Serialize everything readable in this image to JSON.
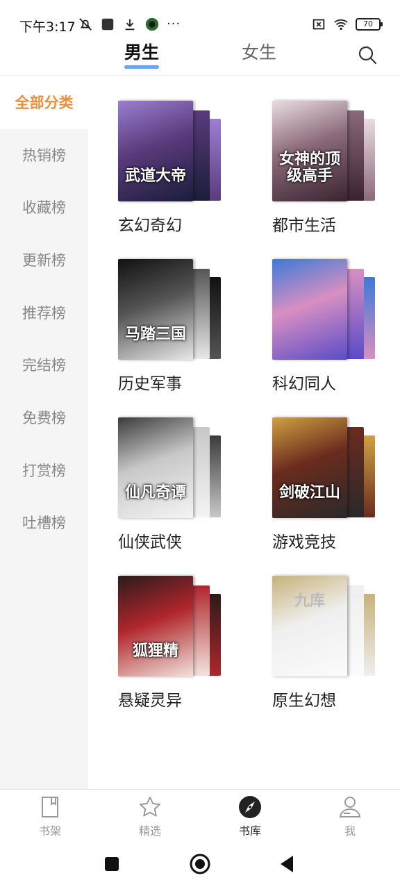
{
  "status_bar": {
    "time": "下午3:17",
    "battery": "70",
    "icons_left": [
      "mute-icon",
      "app-square-icon",
      "download-icon",
      "app-badge-icon",
      "more-dots-icon"
    ],
    "more": "···",
    "icons_right": [
      "sim-error-icon",
      "wifi-icon",
      "battery-icon"
    ]
  },
  "top_tabs": {
    "male": "男生",
    "female": "女生",
    "active": "male"
  },
  "sidebar": {
    "items": [
      {
        "label": "全部分类",
        "active": true
      },
      {
        "label": "热销榜"
      },
      {
        "label": "收藏榜"
      },
      {
        "label": "更新榜"
      },
      {
        "label": "推荐榜"
      },
      {
        "label": "完结榜"
      },
      {
        "label": "免费榜"
      },
      {
        "label": "打赏榜"
      },
      {
        "label": "吐槽榜"
      }
    ]
  },
  "categories": [
    {
      "label": "玄幻奇幻",
      "cover_title": "武道大帝",
      "colors": [
        "#1b1d3a",
        "#5a3b7c",
        "#9b7fd1"
      ]
    },
    {
      "label": "都市生活",
      "cover_title": "女神的顶级高手",
      "colors": [
        "#3a2430",
        "#8b6a7a",
        "#e9dce2"
      ]
    },
    {
      "label": "历史军事",
      "cover_title": "马踏三国",
      "colors": [
        "#e8e8e8",
        "#555555",
        "#111111"
      ]
    },
    {
      "label": "科幻同人",
      "cover_title": "",
      "colors": [
        "#5a4cc8",
        "#d88fc2",
        "#3c7ad6"
      ]
    },
    {
      "label": "仙侠武侠",
      "cover_title": "仙凡奇谭",
      "colors": [
        "#f4f4f4",
        "#c8c8c8",
        "#3b3b3b"
      ]
    },
    {
      "label": "游戏竞技",
      "cover_title": "剑破江山",
      "colors": [
        "#2a2a2a",
        "#6b2b1f",
        "#d0a042"
      ]
    },
    {
      "label": "悬疑灵异",
      "cover_title": "狐狸精",
      "colors": [
        "#f1e3dc",
        "#b0262c",
        "#2c1b1b"
      ]
    },
    {
      "label": "原生幻想",
      "cover_title": "九库",
      "colors": [
        "#fbfbfb",
        "#efefef",
        "#c8b27a"
      ]
    }
  ],
  "bottom_nav": {
    "items": [
      {
        "label": "书架",
        "icon": "bookmark-book-icon"
      },
      {
        "label": "精选",
        "icon": "star-icon"
      },
      {
        "label": "书库",
        "icon": "compass-icon",
        "active": true
      },
      {
        "label": "我",
        "icon": "user-icon"
      }
    ]
  },
  "system_nav": [
    "recent-apps-button",
    "home-button",
    "back-button"
  ]
}
